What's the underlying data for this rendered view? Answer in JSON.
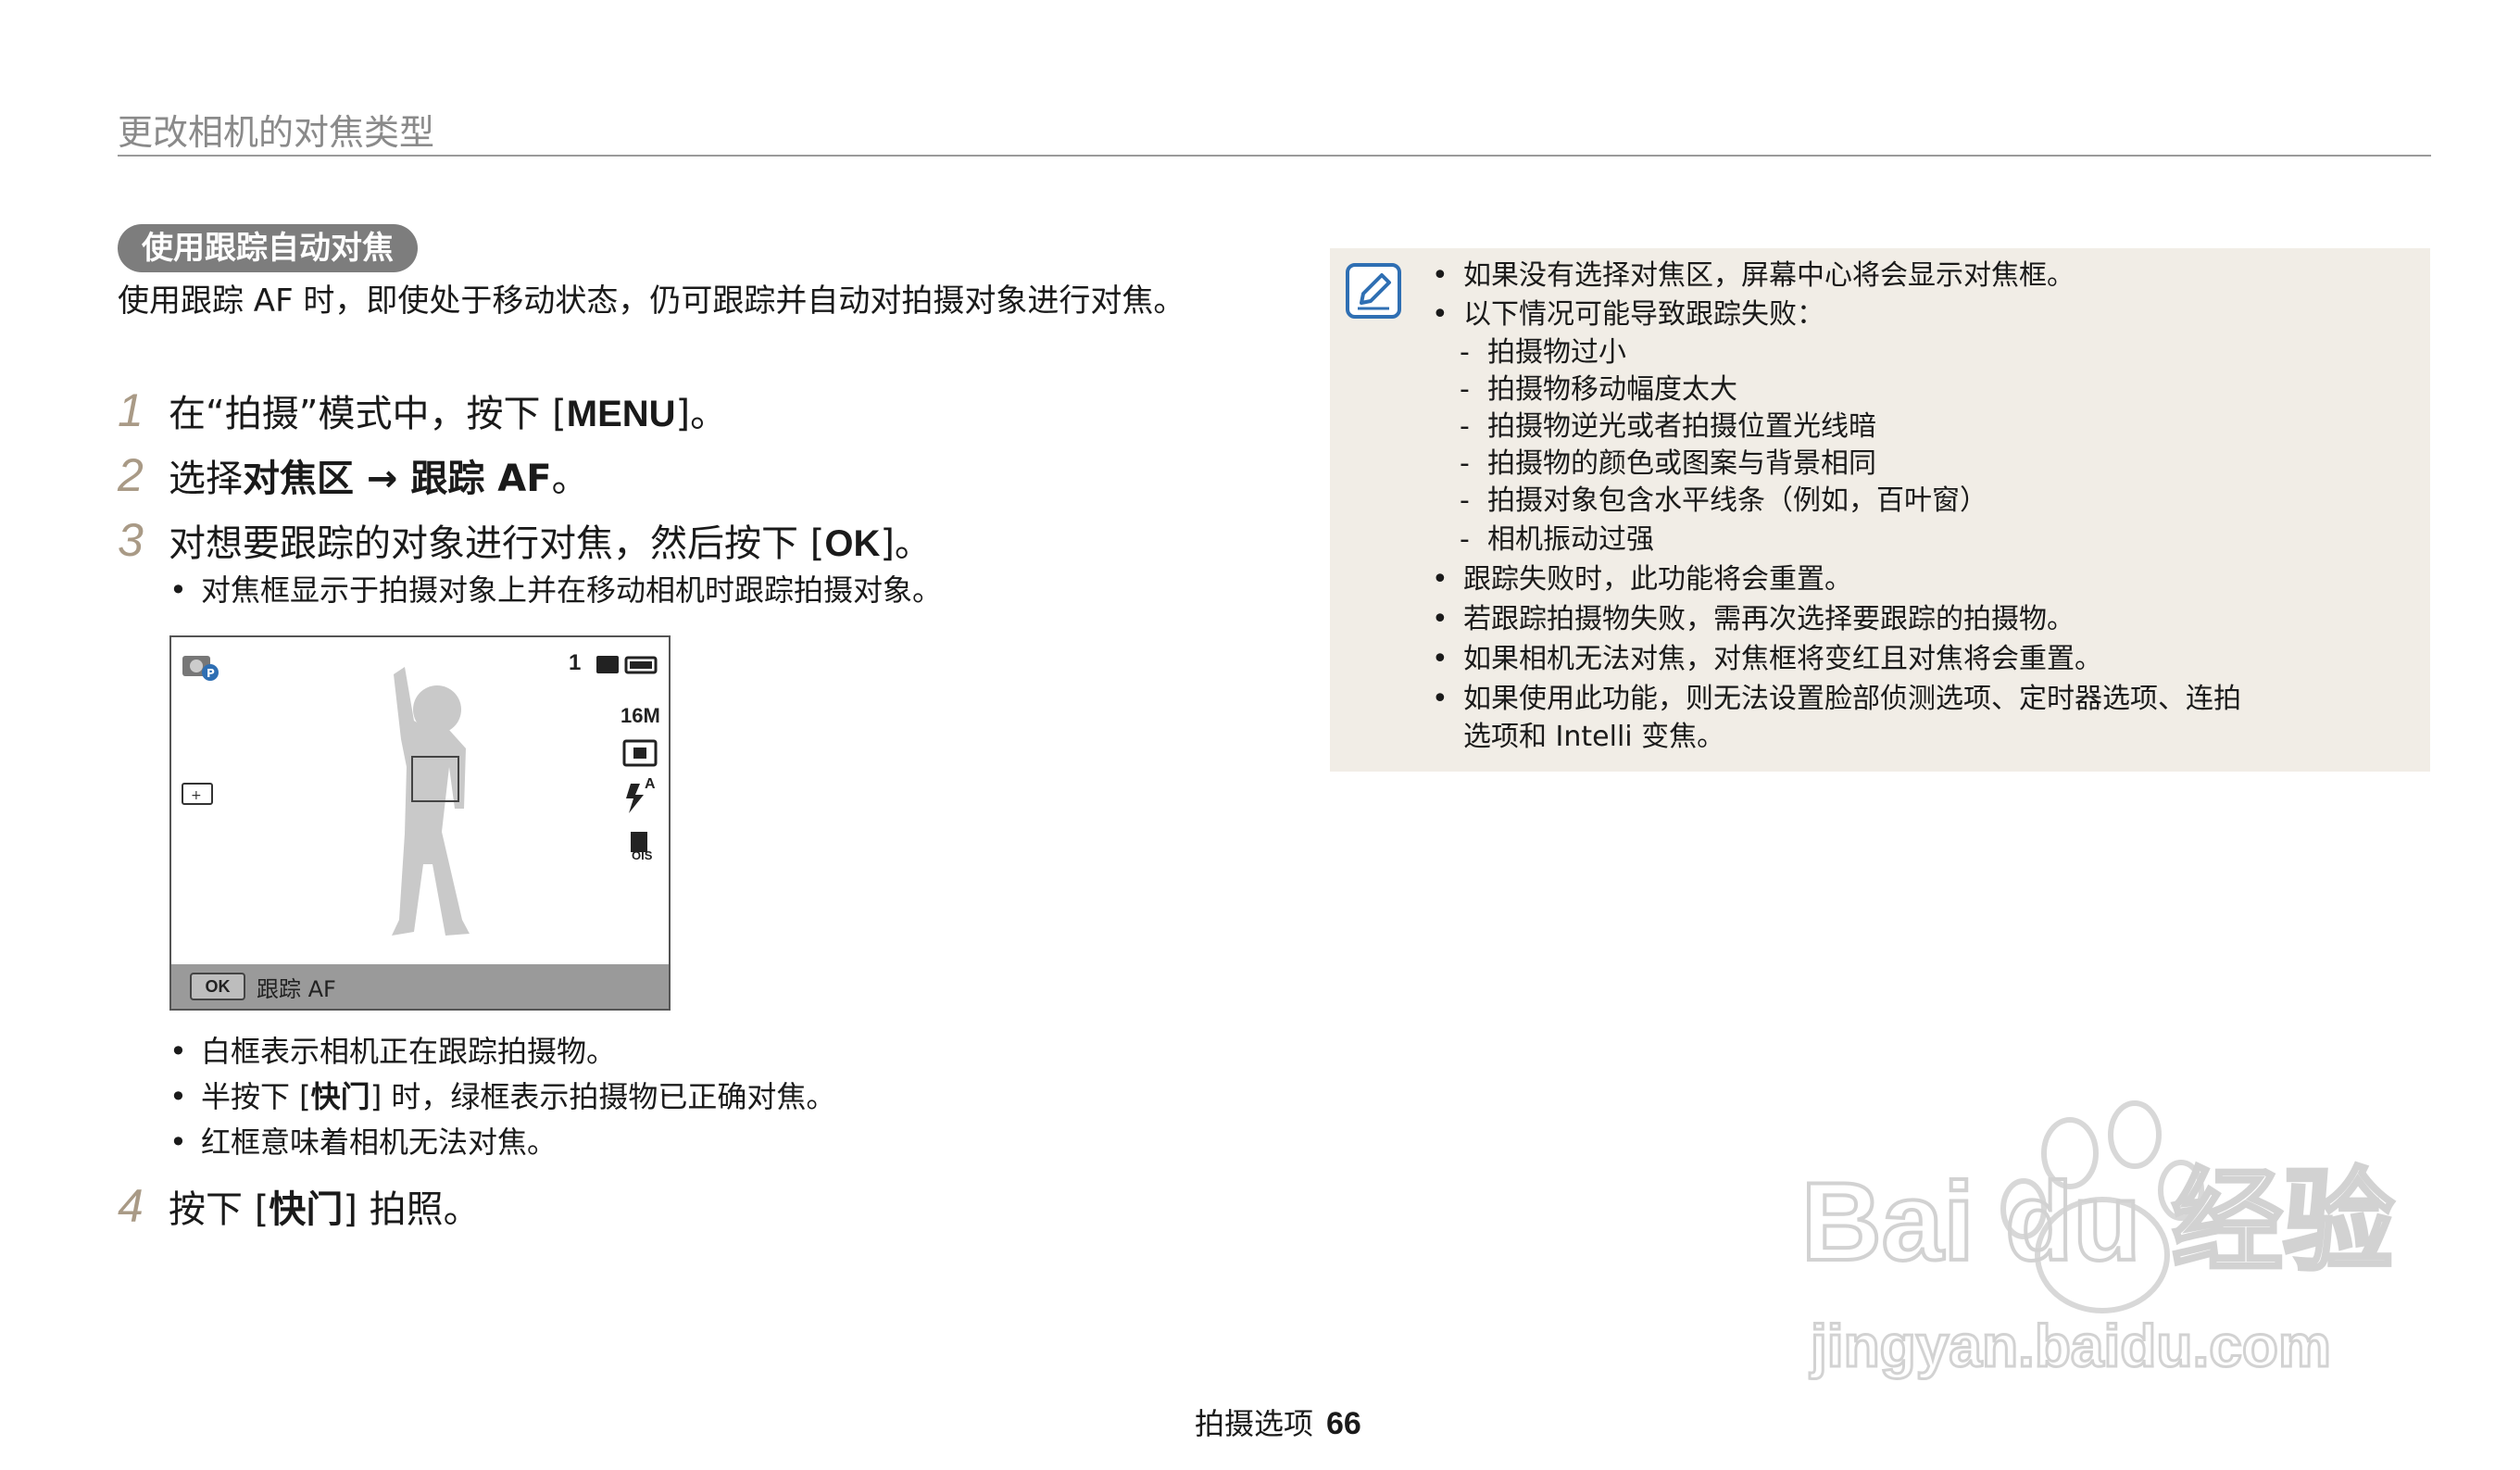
{
  "header": {
    "title": "更改相机的对焦类型"
  },
  "section": {
    "title": "使用跟踪自动对焦",
    "intro": "使用跟踪 AF 时，即使处于移动状态，仍可跟踪并自动对拍摄对象进行对焦。"
  },
  "steps": [
    {
      "num": "1",
      "pre": "在“拍摄”模式中，按下 [",
      "key": "MENU",
      "post": "]。"
    },
    {
      "num": "2",
      "pre": "选择",
      "bold1": "对焦区",
      "arrow": " → ",
      "bold2": "跟踪 AF",
      "post": "。"
    },
    {
      "num": "3",
      "pre": "对想要跟踪的对象进行对焦，然后按下 [",
      "key": "OK",
      "post": "]。"
    },
    {
      "num": "4",
      "pre": "按下 [",
      "bold1": "快门",
      "post": "] 拍照。"
    }
  ],
  "step3_bullet": "对焦框显示于拍摄对象上并在移动相机时跟踪拍摄对象。",
  "camera_screen": {
    "shots_remaining": "1",
    "resolution": "16M",
    "flash_mode": "A",
    "ois": "OIS",
    "bottom_key": "OK",
    "bottom_label": "跟踪 AF"
  },
  "after_bullets": [
    "白框表示相机正在跟踪拍摄物。",
    {
      "pre": "半按下 [",
      "bold": "快门",
      "post": "] 时，绿框表示拍摄物已正确对焦。"
    },
    "红框意味着相机无法对焦。"
  ],
  "note": {
    "items": [
      "如果没有选择对焦区，屏幕中心将会显示对焦框。",
      "以下情况可能导致跟踪失败："
    ],
    "sub_items": [
      "拍摄物过小",
      "拍摄物移动幅度太大",
      "拍摄物逆光或者拍摄位置光线暗",
      "拍摄物的颜色或图案与背景相同",
      "拍摄对象包含水平线条（例如，百叶窗）",
      "相机振动过强"
    ],
    "items2": [
      "跟踪失败时，此功能将会重置。",
      "若跟踪拍摄物失败，需再次选择要跟踪的拍摄物。",
      "如果相机无法对焦，对焦框将变红且对焦将会重置。",
      "如果使用此功能，则无法设置脸部侦测选项、定时器选项、连拍",
      "选项和 Intelli 变焦。"
    ]
  },
  "footer": {
    "section": "拍摄选项",
    "page": "66"
  },
  "watermark": {
    "brand": "Bai du 经验",
    "url": "jingyan.baidu.com"
  },
  "colors": {
    "pill": "#7d7d7d",
    "note_bg": "#f1ede6",
    "step_num": "#a99a86",
    "icon_blue": "#2f6fb3"
  }
}
